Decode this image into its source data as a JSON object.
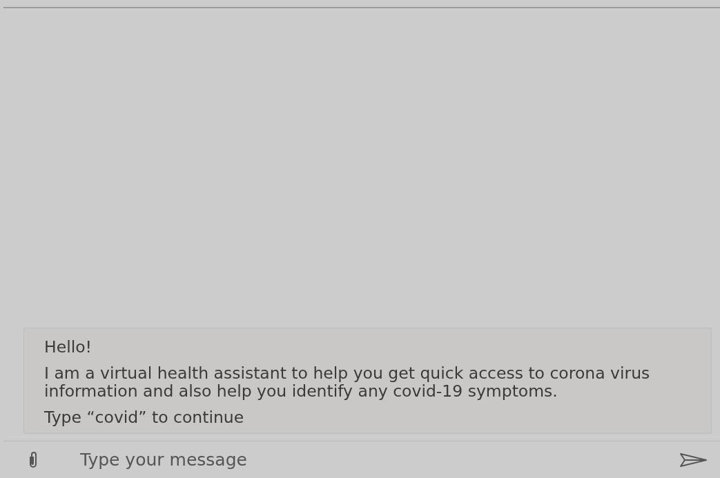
{
  "messages": [
    {
      "paragraphs": [
        "Hello!",
        "I am a virtual health assistant to help you get quick access to corona virus information and also help you identify any covid-19 symptoms.",
        "Type “covid” to continue"
      ]
    }
  ],
  "composer": {
    "placeholder": "Type your message"
  }
}
